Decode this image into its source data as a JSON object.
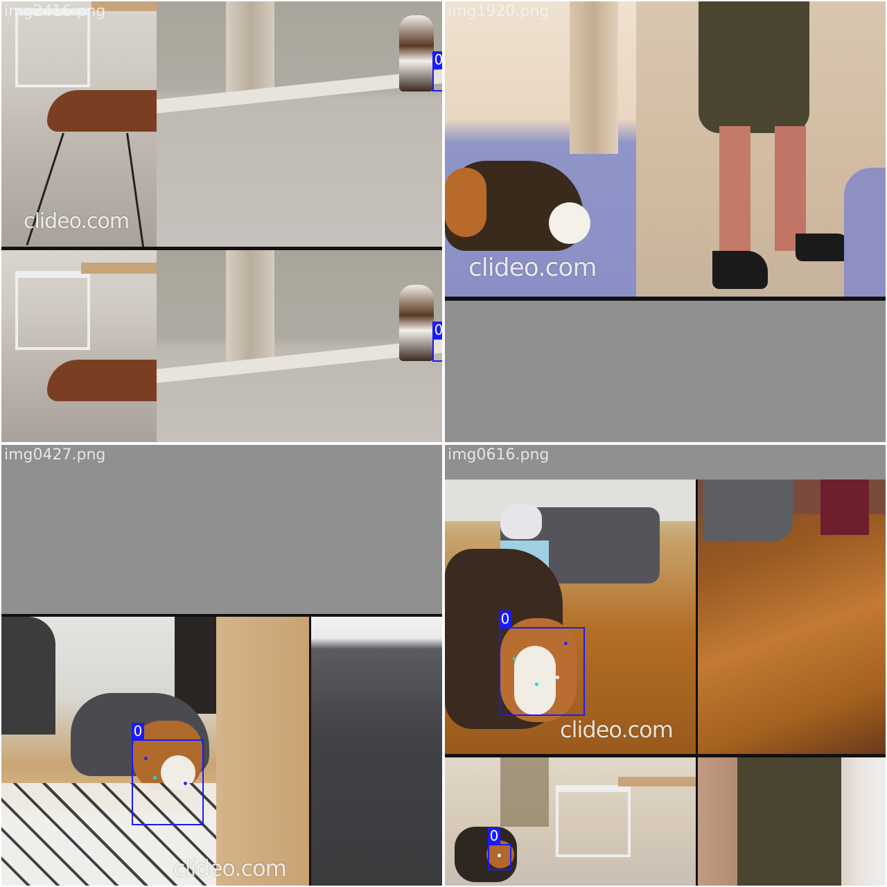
{
  "tiles": [
    {
      "filename": "img2416.png",
      "watermark": "clideo.com",
      "detections": [
        {
          "label": "0"
        },
        {
          "label": "0"
        }
      ]
    },
    {
      "filename": "img1920.png",
      "watermark": "clideo.com",
      "detections": []
    },
    {
      "filename": "img0427.png",
      "watermark": "clideo.com",
      "detections": [
        {
          "label": "0"
        }
      ]
    },
    {
      "filename": "img0616.png",
      "watermark": "clideo.com",
      "detections": [
        {
          "label": "0"
        },
        {
          "label": "0"
        }
      ]
    }
  ],
  "colors": {
    "bbox": "#1a1aff",
    "keypoint_cyan": "#00e5e5",
    "keypoint_white": "#ffffff",
    "keypoint_blue": "#2a2aff",
    "padding_gray": "#909090"
  }
}
